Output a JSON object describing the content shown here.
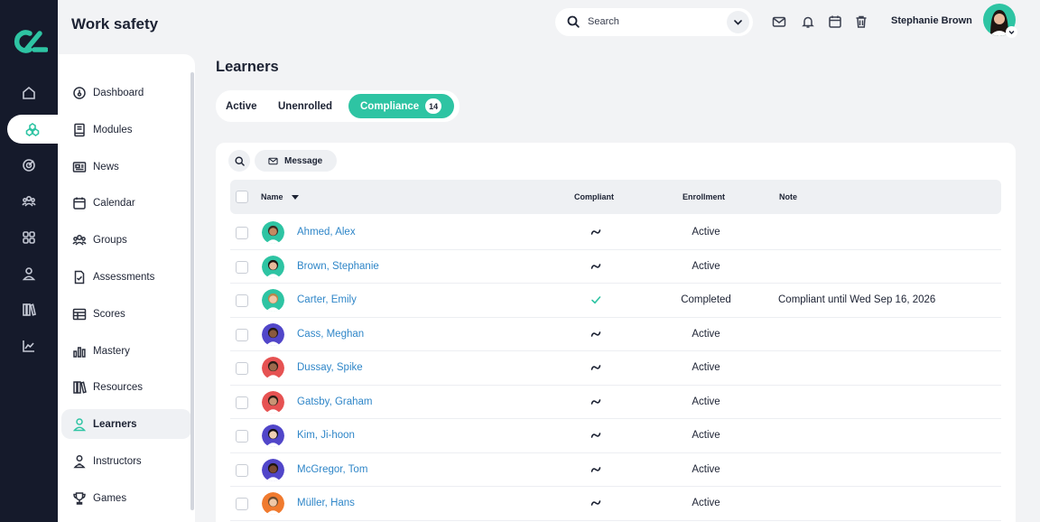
{
  "app": {
    "title": "Work safety"
  },
  "header": {
    "search_placeholder": "Search",
    "user_name": "Stephanie Brown",
    "icons": [
      "mail-icon",
      "bell-icon",
      "calendar-icon",
      "trash-icon"
    ]
  },
  "rail": {
    "icons": [
      "home-icon",
      "cubes-icon",
      "target-icon",
      "users-icon",
      "grid-icon",
      "user-icon",
      "library-icon",
      "chart-icon"
    ],
    "active_index": 1
  },
  "sidebar": {
    "items": [
      {
        "label": "Dashboard",
        "icon": "gauge-icon"
      },
      {
        "label": "Modules",
        "icon": "book-icon"
      },
      {
        "label": "News",
        "icon": "newspaper-icon"
      },
      {
        "label": "Calendar",
        "icon": "calendar-icon"
      },
      {
        "label": "Groups",
        "icon": "groups-icon"
      },
      {
        "label": "Assessments",
        "icon": "file-check-icon"
      },
      {
        "label": "Scores",
        "icon": "table-icon"
      },
      {
        "label": "Mastery",
        "icon": "bars-icon"
      },
      {
        "label": "Resources",
        "icon": "library-icon"
      },
      {
        "label": "Learners",
        "icon": "user-icon"
      },
      {
        "label": "Instructors",
        "icon": "instructor-icon"
      },
      {
        "label": "Games",
        "icon": "trophy-icon"
      }
    ],
    "active_index": 9
  },
  "main": {
    "title": "Learners",
    "tabs": [
      {
        "label": "Active"
      },
      {
        "label": "Unenrolled"
      },
      {
        "label": "Compliance",
        "count": "14"
      }
    ],
    "toolbar": {
      "message_label": "Message"
    },
    "table": {
      "headers": {
        "name": "Name",
        "compliant": "Compliant",
        "enrollment": "Enrollment",
        "note": "Note"
      },
      "rows": [
        {
          "name": "Ahmed, Alex",
          "compliant": "approx",
          "enrollment": "Active",
          "note": "",
          "avatar_bg": "#2ec4a3",
          "skin": "#c68a62",
          "hair": "#3b2a20"
        },
        {
          "name": "Brown, Stephanie",
          "compliant": "approx",
          "enrollment": "Active",
          "note": "",
          "avatar_bg": "#2ec4a3",
          "skin": "#e9b99b",
          "hair": "#1e1512"
        },
        {
          "name": "Carter, Emily",
          "compliant": "check",
          "enrollment": "Completed",
          "note": "Compliant until Wed Sep 16, 2026",
          "avatar_bg": "#2ec4a3",
          "skin": "#f1c7a8",
          "hair": "#b8874b"
        },
        {
          "name": "Cass, Meghan",
          "compliant": "approx",
          "enrollment": "Active",
          "note": "",
          "avatar_bg": "#5146c9",
          "skin": "#8a5a3d",
          "hair": "#231814"
        },
        {
          "name": "Dussay, Spike",
          "compliant": "approx",
          "enrollment": "Active",
          "note": "",
          "avatar_bg": "#e65252",
          "skin": "#9c6a4d",
          "hair": "#2a1c16"
        },
        {
          "name": "Gatsby, Graham",
          "compliant": "approx",
          "enrollment": "Active",
          "note": "",
          "avatar_bg": "#e65252",
          "skin": "#c99575",
          "hair": "#2a1c16"
        },
        {
          "name": "Kim, Ji-hoon",
          "compliant": "approx",
          "enrollment": "Active",
          "note": "",
          "avatar_bg": "#5146c9",
          "skin": "#f0d0b4",
          "hair": "#151015"
        },
        {
          "name": "McGregor, Tom",
          "compliant": "approx",
          "enrollment": "Active",
          "note": "",
          "avatar_bg": "#5146c9",
          "skin": "#7a4a33",
          "hair": "#1d1410"
        },
        {
          "name": "Müller, Hans",
          "compliant": "approx",
          "enrollment": "Active",
          "note": "",
          "avatar_bg": "#f07a2e",
          "skin": "#f0c9a8",
          "hair": "#6b4a2d"
        }
      ]
    }
  },
  "colors": {
    "accent": "#2ec4a3",
    "rail_bg": "#151a2b",
    "link": "#2f86c8"
  }
}
